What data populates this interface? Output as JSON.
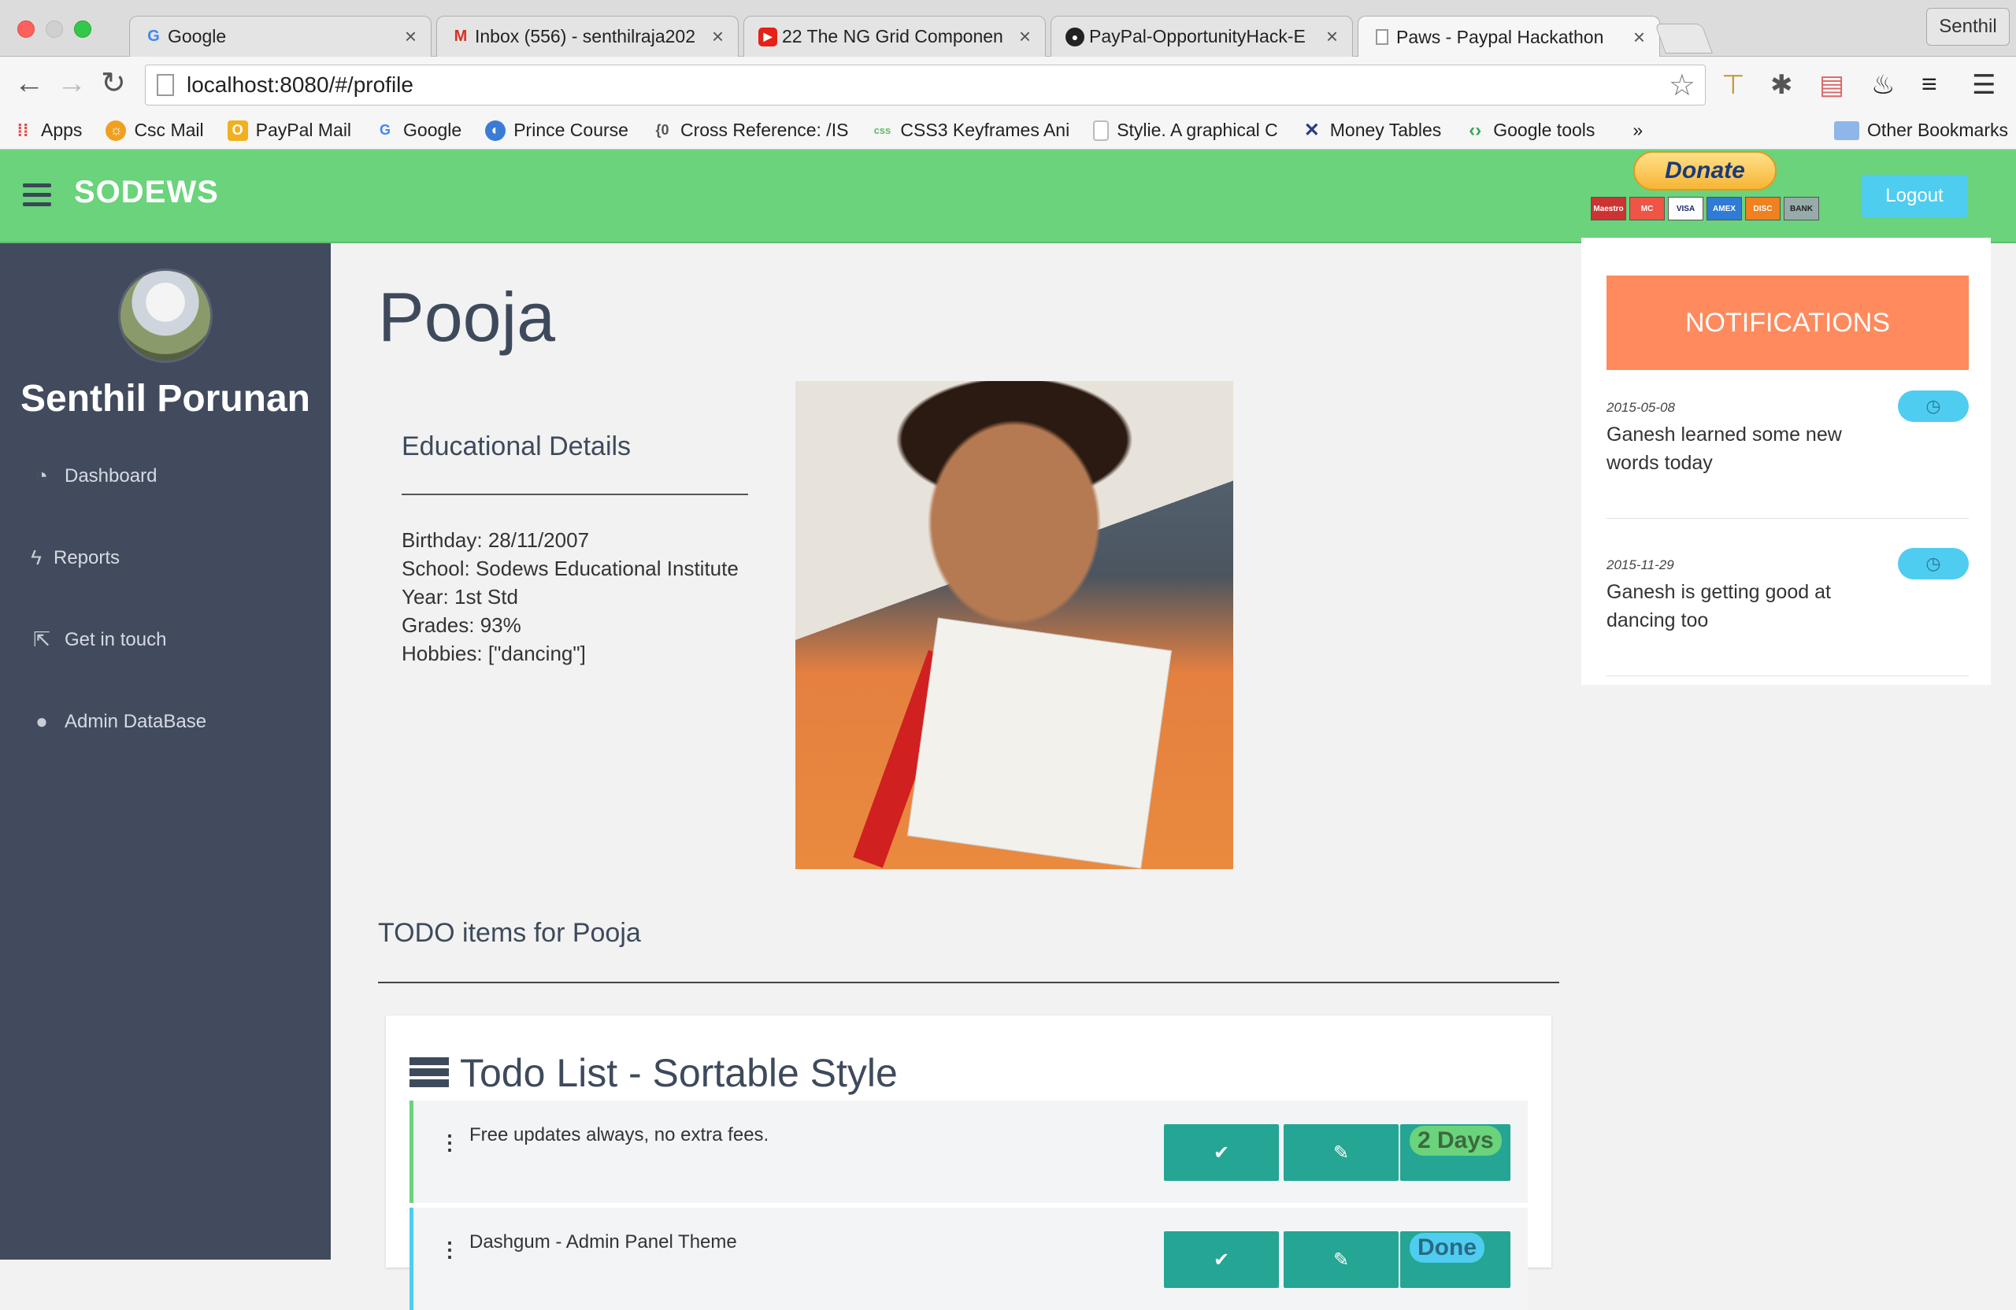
{
  "browser": {
    "tabs": [
      {
        "title": "Google",
        "favicon": "google-icon",
        "color": "#4285f4"
      },
      {
        "title": "Inbox (556) - senthilraja202",
        "favicon": "gmail-icon",
        "color": "#d93025"
      },
      {
        "title": "22 The NG Grid Componen",
        "favicon": "youtube-icon",
        "color": "#e62117"
      },
      {
        "title": "PayPal-OpportunityHack-E",
        "favicon": "github-icon",
        "color": "#222222"
      },
      {
        "title": "Paws - Paypal Hackathon",
        "favicon": "page-icon",
        "color": "#999999"
      }
    ],
    "profile_name": "Senthil",
    "url": "localhost:8080/#/profile",
    "bookmarks": [
      {
        "label": "Apps",
        "icon": "apps-grid-icon",
        "color": "#e44"
      },
      {
        "label": "Csc Mail",
        "icon": "csc-icon",
        "color": "#f0a020"
      },
      {
        "label": "PayPal Mail",
        "icon": "paypal-mail-icon",
        "color": "#f0b020"
      },
      {
        "label": "Google",
        "icon": "google-icon",
        "color": "#4285f4"
      },
      {
        "label": "Prince Course",
        "icon": "prince-icon",
        "color": "#3a7bd5"
      },
      {
        "label": "Cross Reference: /IS",
        "icon": "bracket-icon",
        "color": "#888"
      },
      {
        "label": "CSS3 Keyframes Ani",
        "icon": "css3-icon",
        "color": "#6b6"
      },
      {
        "label": "Stylie. A graphical C",
        "icon": "page-icon",
        "color": "#bbb"
      },
      {
        "label": "Money Tables",
        "icon": "money-tables-icon",
        "color": "#2a3a8a"
      },
      {
        "label": "Google tools",
        "icon": "google-tools-icon",
        "color": "#34a853"
      }
    ],
    "bookmarks_overflow": "»",
    "other_bookmarks": "Other Bookmarks"
  },
  "header": {
    "brand": "SODEWS",
    "donate_label": "Donate",
    "card_logos": [
      "Maestro",
      "MC",
      "VISA",
      "AMEX",
      "DISC",
      "BANK"
    ],
    "logout_label": "Logout",
    "color": "#6ad37b"
  },
  "sidebar": {
    "user_name": "Senthil Porunan",
    "items": [
      {
        "label": "Dashboard",
        "icon": "dashboard-icon"
      },
      {
        "label": "Reports",
        "icon": "bolt-icon"
      },
      {
        "label": "Get in touch",
        "icon": "share-icon"
      },
      {
        "label": "Admin DataBase",
        "icon": "user-icon"
      }
    ]
  },
  "profile": {
    "name": "Pooja",
    "edu_heading": "Educational Details",
    "details": [
      "Birthday: 28/11/2007",
      "School: Sodews Educational Institute",
      "Year: 1st Std",
      "Grades: 93%",
      "Hobbies: [\"dancing\"]"
    ],
    "todo_heading": "TODO items for Pooja"
  },
  "todo_panel": {
    "title": "Todo List - Sortable Style",
    "items": [
      {
        "text": "Free updates always, no extra fees.",
        "badge": "2 Days",
        "bar_color": "#6ad37b"
      },
      {
        "text": "Dashgum - Admin Panel Theme",
        "badge": "Done",
        "bar_color": "#4ecdf1"
      }
    ]
  },
  "notifications": {
    "heading": "NOTIFICATIONS",
    "items": [
      {
        "date": "2015-05-08",
        "text": "Ganesh learned some new words today"
      },
      {
        "date": "2015-11-29",
        "text": "Ganesh is getting good at dancing too"
      }
    ]
  }
}
